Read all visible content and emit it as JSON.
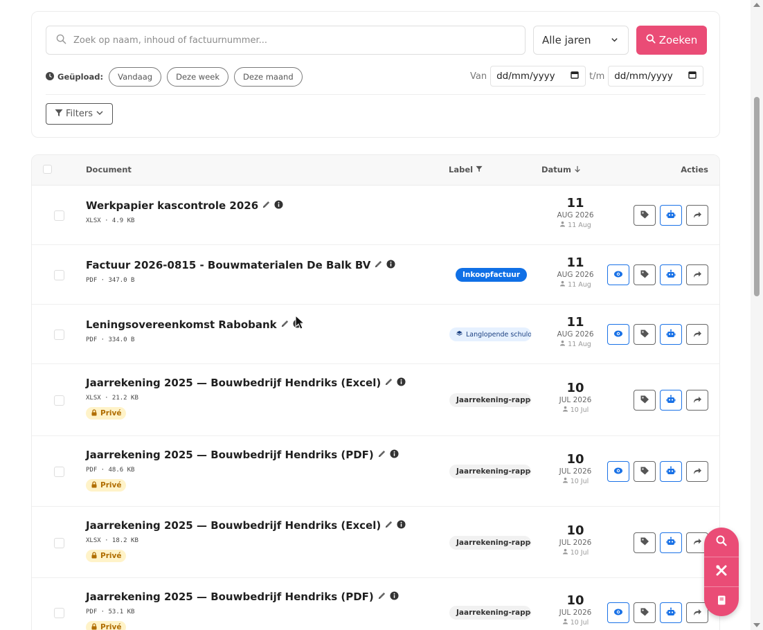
{
  "search": {
    "placeholder": "Zoek op naam, inhoud of factuurnummer...",
    "year_value": "Alle jaren",
    "button_label": "Zoeken"
  },
  "uploaded": {
    "label": "Geüpload:",
    "chips": [
      "Vandaag",
      "Deze week",
      "Deze maand"
    ]
  },
  "date_range": {
    "from_label": "Van",
    "from_placeholder": "dd/mm/yyyy",
    "to_label": "t/m",
    "to_placeholder": "dd/mm/yyyy"
  },
  "filters_label": "Filters",
  "table": {
    "headers": {
      "document": "Document",
      "label": "Label",
      "date": "Datum",
      "actions": "Acties"
    },
    "rows": [
      {
        "title": "Werkpapier kascontrole 2026",
        "meta": "XLSX · 4.9 KB",
        "label": "",
        "day": "11",
        "month": "AUG 2026",
        "uploaded": "11 Aug",
        "private": false,
        "has_view": false
      },
      {
        "title": "Factuur 2026-0815 - Bouwmaterialen De Balk BV",
        "meta": "PDF · 347.0 B",
        "label": "Inkoopfactuur",
        "label_style": "blue",
        "day": "11",
        "month": "AUG 2026",
        "uploaded": "11 Aug",
        "private": false,
        "has_view": true
      },
      {
        "title": "Leningsovereenkomst Rabobank",
        "meta": "PDF · 334.0 B",
        "label": "Langlopende schulden",
        "label_style": "lightblue",
        "day": "11",
        "month": "AUG 2026",
        "uploaded": "11 Aug",
        "private": false,
        "has_view": true
      },
      {
        "title": "Jaarrekening 2025 — Bouwbedrijf Hendriks (Excel)",
        "meta": "XLSX · 21.2 KB",
        "label": "Jaarrekening-rapport",
        "label_style": "grey",
        "day": "10",
        "month": "JUL 2026",
        "uploaded": "10 Jul",
        "private": true,
        "has_view": false
      },
      {
        "title": "Jaarrekening 2025 — Bouwbedrijf Hendriks (PDF)",
        "meta": "PDF · 48.6 KB",
        "label": "Jaarrekening-rapport",
        "label_style": "grey",
        "day": "10",
        "month": "JUL 2026",
        "uploaded": "10 Jul",
        "private": true,
        "has_view": true
      },
      {
        "title": "Jaarrekening 2025 — Bouwbedrijf Hendriks (Excel)",
        "meta": "XLSX · 18.2 KB",
        "label": "Jaarrekening-rapport",
        "label_style": "grey",
        "day": "10",
        "month": "JUL 2026",
        "uploaded": "10 Jul",
        "private": true,
        "has_view": false
      },
      {
        "title": "Jaarrekening 2025 — Bouwbedrijf Hendriks (PDF)",
        "meta": "PDF · 53.1 KB",
        "label": "Jaarrekening-rapport",
        "label_style": "grey",
        "day": "10",
        "month": "JUL 2026",
        "uploaded": "10 Jul",
        "private": true,
        "has_view": true
      }
    ]
  },
  "private_label": "Privé",
  "colors": {
    "accent": "#ea4c76",
    "blue": "#1070e6"
  }
}
